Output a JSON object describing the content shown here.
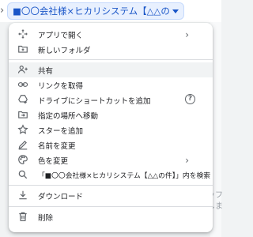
{
  "breadcrumb": {
    "chevron": "›",
    "folder_title": "■〇〇会社様×ヒカリシステム【△△の件】"
  },
  "background": {
    "snippet1": "ッフ",
    "snippet2": "しま"
  },
  "menu": {
    "items": [
      {
        "name": "open-with",
        "label": "アプリで開く",
        "icon": "move-arrows-icon",
        "has_submenu": true
      },
      {
        "name": "new-folder",
        "label": "新しいフォルダ",
        "icon": "new-folder-icon"
      },
      {
        "name": "share",
        "label": "共有",
        "icon": "person-add-icon"
      },
      {
        "name": "get-link",
        "label": "リンクを取得",
        "icon": "link-icon"
      },
      {
        "name": "add-shortcut",
        "label": "ドライブにショートカットを追加",
        "icon": "drive-shortcut-icon",
        "has_help": true
      },
      {
        "name": "move-to",
        "label": "指定の場所へ移動",
        "icon": "move-folder-icon"
      },
      {
        "name": "add-star",
        "label": "スターを追加",
        "icon": "star-icon"
      },
      {
        "name": "rename",
        "label": "名前を変更",
        "icon": "pencil-icon"
      },
      {
        "name": "change-color",
        "label": "色を変更",
        "icon": "palette-icon",
        "has_submenu": true
      },
      {
        "name": "search-within",
        "label": "「■〇〇会社様×ヒカリシステム【△△の件】」内を検索",
        "icon": "search-icon"
      },
      {
        "name": "download",
        "label": "ダウンロード",
        "icon": "download-icon"
      },
      {
        "name": "remove",
        "label": "削除",
        "icon": "trash-icon"
      }
    ],
    "submenu_glyph": "›",
    "help_glyph": "?"
  },
  "colors": {
    "accent": "#1a56c8",
    "hover_bg": "#f1f3f4",
    "icon": "#5f6368"
  }
}
